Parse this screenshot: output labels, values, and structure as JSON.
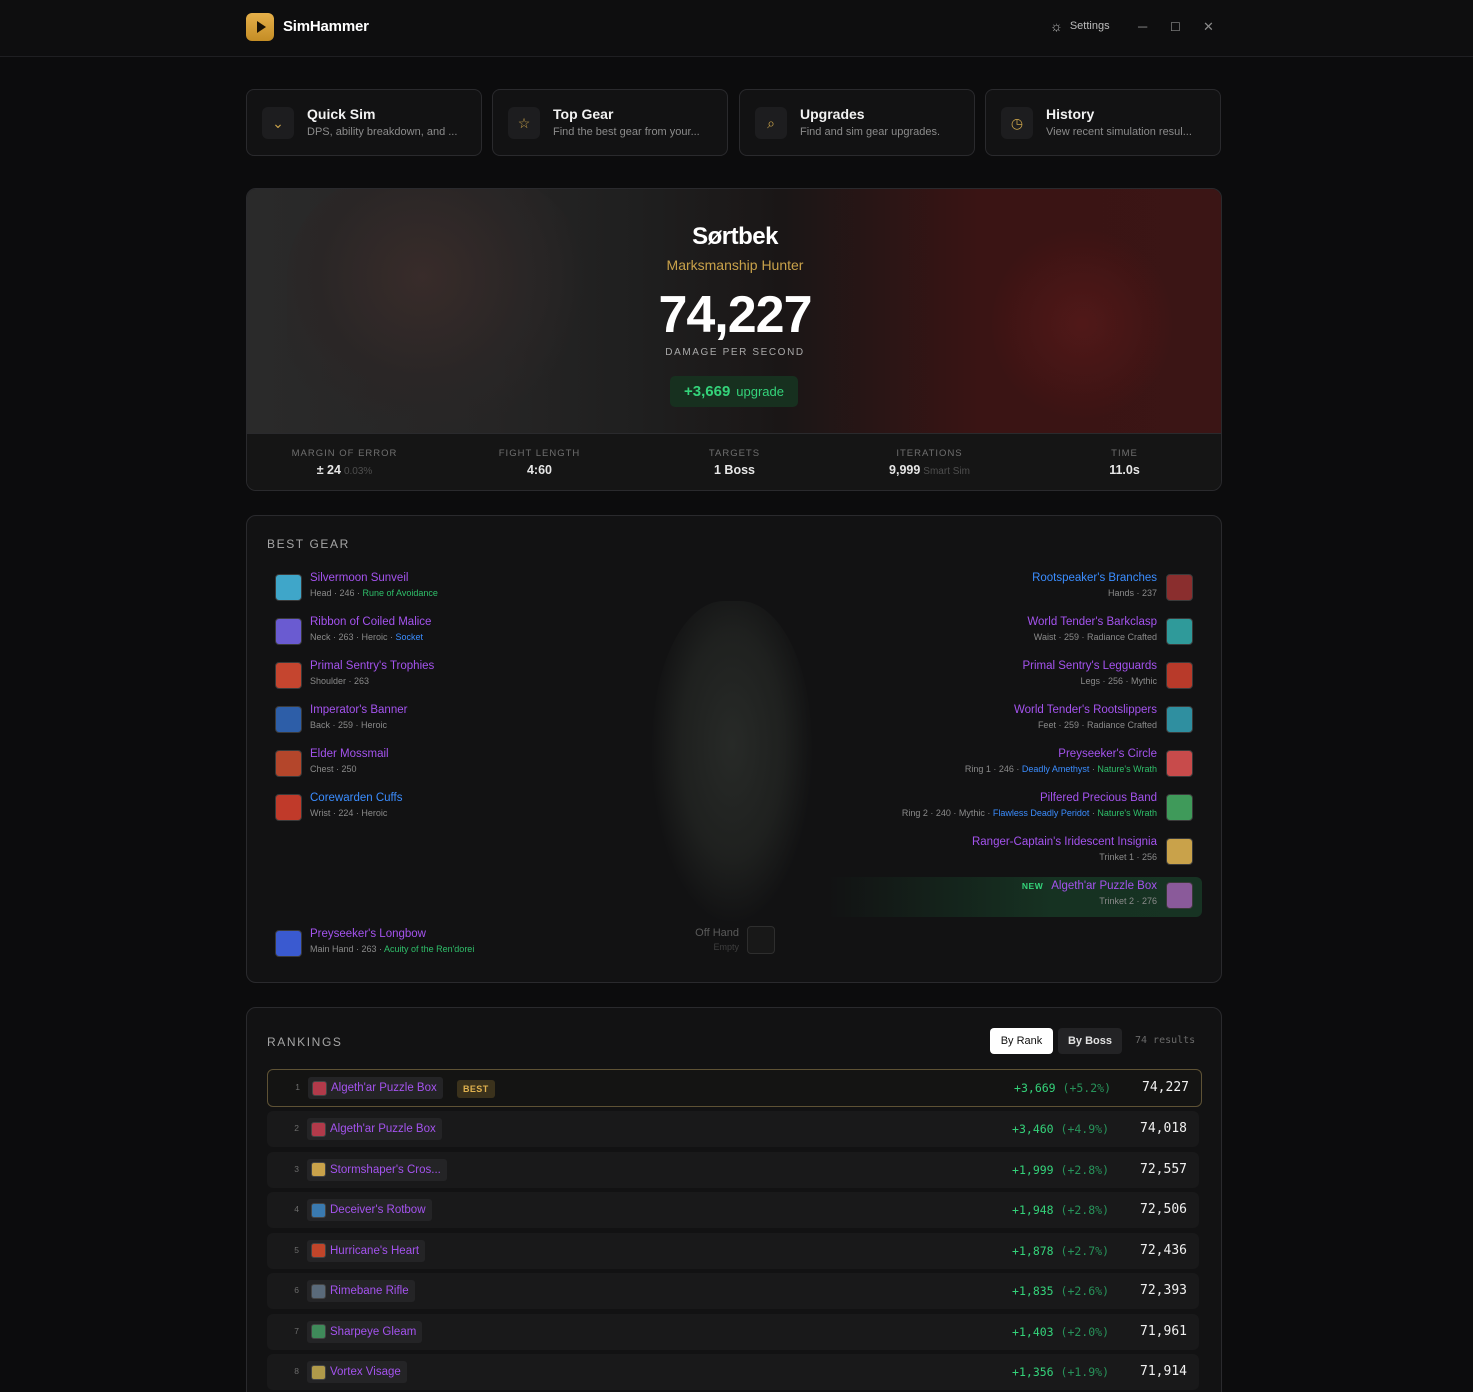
{
  "app": {
    "title": "SimHammer",
    "settings_label": "Settings"
  },
  "nav": [
    {
      "title": "Quick Sim",
      "desc": "DPS, ability breakdown, and ...",
      "icon": "chevron-down-icon"
    },
    {
      "title": "Top Gear",
      "desc": "Find the best gear from your...",
      "icon": "star-icon"
    },
    {
      "title": "Upgrades",
      "desc": "Find and sim gear upgrades.",
      "icon": "search-icon"
    },
    {
      "title": "History",
      "desc": "View recent simulation resul...",
      "icon": "clock-icon"
    }
  ],
  "hero": {
    "name": "Sørtbek",
    "spec": "Marksmanship Hunter",
    "dps": "74,227",
    "dps_label": "DAMAGE PER SECOND",
    "upgrade_value": "+3,669",
    "upgrade_label": "upgrade"
  },
  "stats": [
    {
      "label": "MARGIN OF ERROR",
      "value": "± 24",
      "sub": "0.03%"
    },
    {
      "label": "FIGHT LENGTH",
      "value": "4:60",
      "sub": ""
    },
    {
      "label": "TARGETS",
      "value": "1 Boss",
      "sub": ""
    },
    {
      "label": "ITERATIONS",
      "value": "9,999",
      "sub": "Smart Sim"
    },
    {
      "label": "TIME",
      "value": "11.0s",
      "sub": ""
    }
  ],
  "best_gear": {
    "title": "BEST GEAR",
    "left": [
      {
        "name": "Silvermoon Sunveil",
        "meta": "Head · 246 · ",
        "extra": "Rune of Avoidance",
        "quality": "epic",
        "color": "#3fa6c9"
      },
      {
        "name": "Ribbon of Coiled Malice",
        "meta": "Neck · 263 · Heroic · ",
        "extra_blue": "Socket",
        "quality": "epic",
        "color": "#6a5bd1"
      },
      {
        "name": "Primal Sentry's Trophies",
        "meta": "Shoulder · 263",
        "quality": "epic",
        "color": "#c5452f"
      },
      {
        "name": "Imperator's Banner",
        "meta": "Back · 259 · Heroic",
        "quality": "epic",
        "color": "#2d5ea8"
      },
      {
        "name": "Elder Mossmail",
        "meta": "Chest · 250",
        "quality": "epic",
        "color": "#b4462b"
      },
      {
        "name": "Corewarden Cuffs",
        "meta": "Wrist · 224 · Heroic",
        "quality": "rare",
        "color": "#c03a2a"
      }
    ],
    "right": [
      {
        "name": "Rootspeaker's Branches",
        "meta": "Hands · 237",
        "quality": "rare",
        "color": "#8a2e2e"
      },
      {
        "name": "World Tender's Barkclasp",
        "meta": "Waist · 259 · Radiance Crafted",
        "quality": "epic",
        "color": "#2f9a9a"
      },
      {
        "name": "Primal Sentry's Legguards",
        "meta": "Legs · 256 · Mythic",
        "quality": "epic",
        "color": "#b83a2a"
      },
      {
        "name": "World Tender's Rootslippers",
        "meta": "Feet · 259 · Radiance Crafted",
        "quality": "epic",
        "color": "#2f8fa0"
      },
      {
        "name": "Preyseeker's Circle",
        "meta": "Ring 1 · 246 · ",
        "extra_blue": "Deadly Amethyst",
        "extra": "Nature's Wrath",
        "quality": "epic",
        "color": "#c84b4b"
      },
      {
        "name": "Pilfered Precious Band",
        "meta": "Ring 2 · 240 · Mythic · ",
        "extra_blue": "Flawless Deadly Peridot",
        "extra": "Nature's Wrath",
        "quality": "epic",
        "color": "#3f9a5a"
      },
      {
        "name": "Ranger-Captain's Iridescent Insignia",
        "meta": "Trinket 1 · 256",
        "quality": "epic",
        "color": "#c9a24a"
      },
      {
        "name": "Algeth'ar Puzzle Box",
        "meta": "Trinket 2 · 276",
        "quality": "epic",
        "color": "#8a5a9a",
        "badge": "NEW"
      }
    ],
    "main_hand": {
      "name": "Preyseeker's Longbow",
      "meta": "Main Hand · 263 · ",
      "extra": "Acuity of the Ren'dorei",
      "color": "#3a5ad0"
    },
    "off_hand": {
      "label": "Off Hand",
      "value": "Empty"
    }
  },
  "rankings": {
    "title": "RANKINGS",
    "tabs": [
      "By Rank",
      "By Boss"
    ],
    "results": "74 results",
    "best_badge": "BEST",
    "rows": [
      {
        "rank": "1",
        "item": "Algeth'ar Puzzle Box",
        "delta": "+3,669",
        "pct": "(+5.2%)",
        "dps": "74,227",
        "color": "#b23a4a"
      },
      {
        "rank": "2",
        "item": "Algeth'ar Puzzle Box",
        "delta": "+3,460",
        "pct": "(+4.9%)",
        "dps": "74,018",
        "color": "#b23a4a"
      },
      {
        "rank": "3",
        "item": "Stormshaper's Cros...",
        "delta": "+1,999",
        "pct": "(+2.8%)",
        "dps": "72,557",
        "color": "#c9a24a"
      },
      {
        "rank": "4",
        "item": "Deceiver's Rotbow",
        "delta": "+1,948",
        "pct": "(+2.8%)",
        "dps": "72,506",
        "color": "#3a7ab0"
      },
      {
        "rank": "5",
        "item": "Hurricane's Heart",
        "delta": "+1,878",
        "pct": "(+2.7%)",
        "dps": "72,436",
        "color": "#c0452a"
      },
      {
        "rank": "6",
        "item": "Rimebane Rifle",
        "delta": "+1,835",
        "pct": "(+2.6%)",
        "dps": "72,393",
        "color": "#5a6a7a"
      },
      {
        "rank": "7",
        "item": "Sharpeye Gleam",
        "delta": "+1,403",
        "pct": "(+2.0%)",
        "dps": "71,961",
        "color": "#3f8a5a"
      },
      {
        "rank": "8",
        "item": "Vortex Visage",
        "delta": "+1,356",
        "pct": "(+1.9%)",
        "dps": "71,914",
        "color": "#b09a4a"
      }
    ]
  }
}
